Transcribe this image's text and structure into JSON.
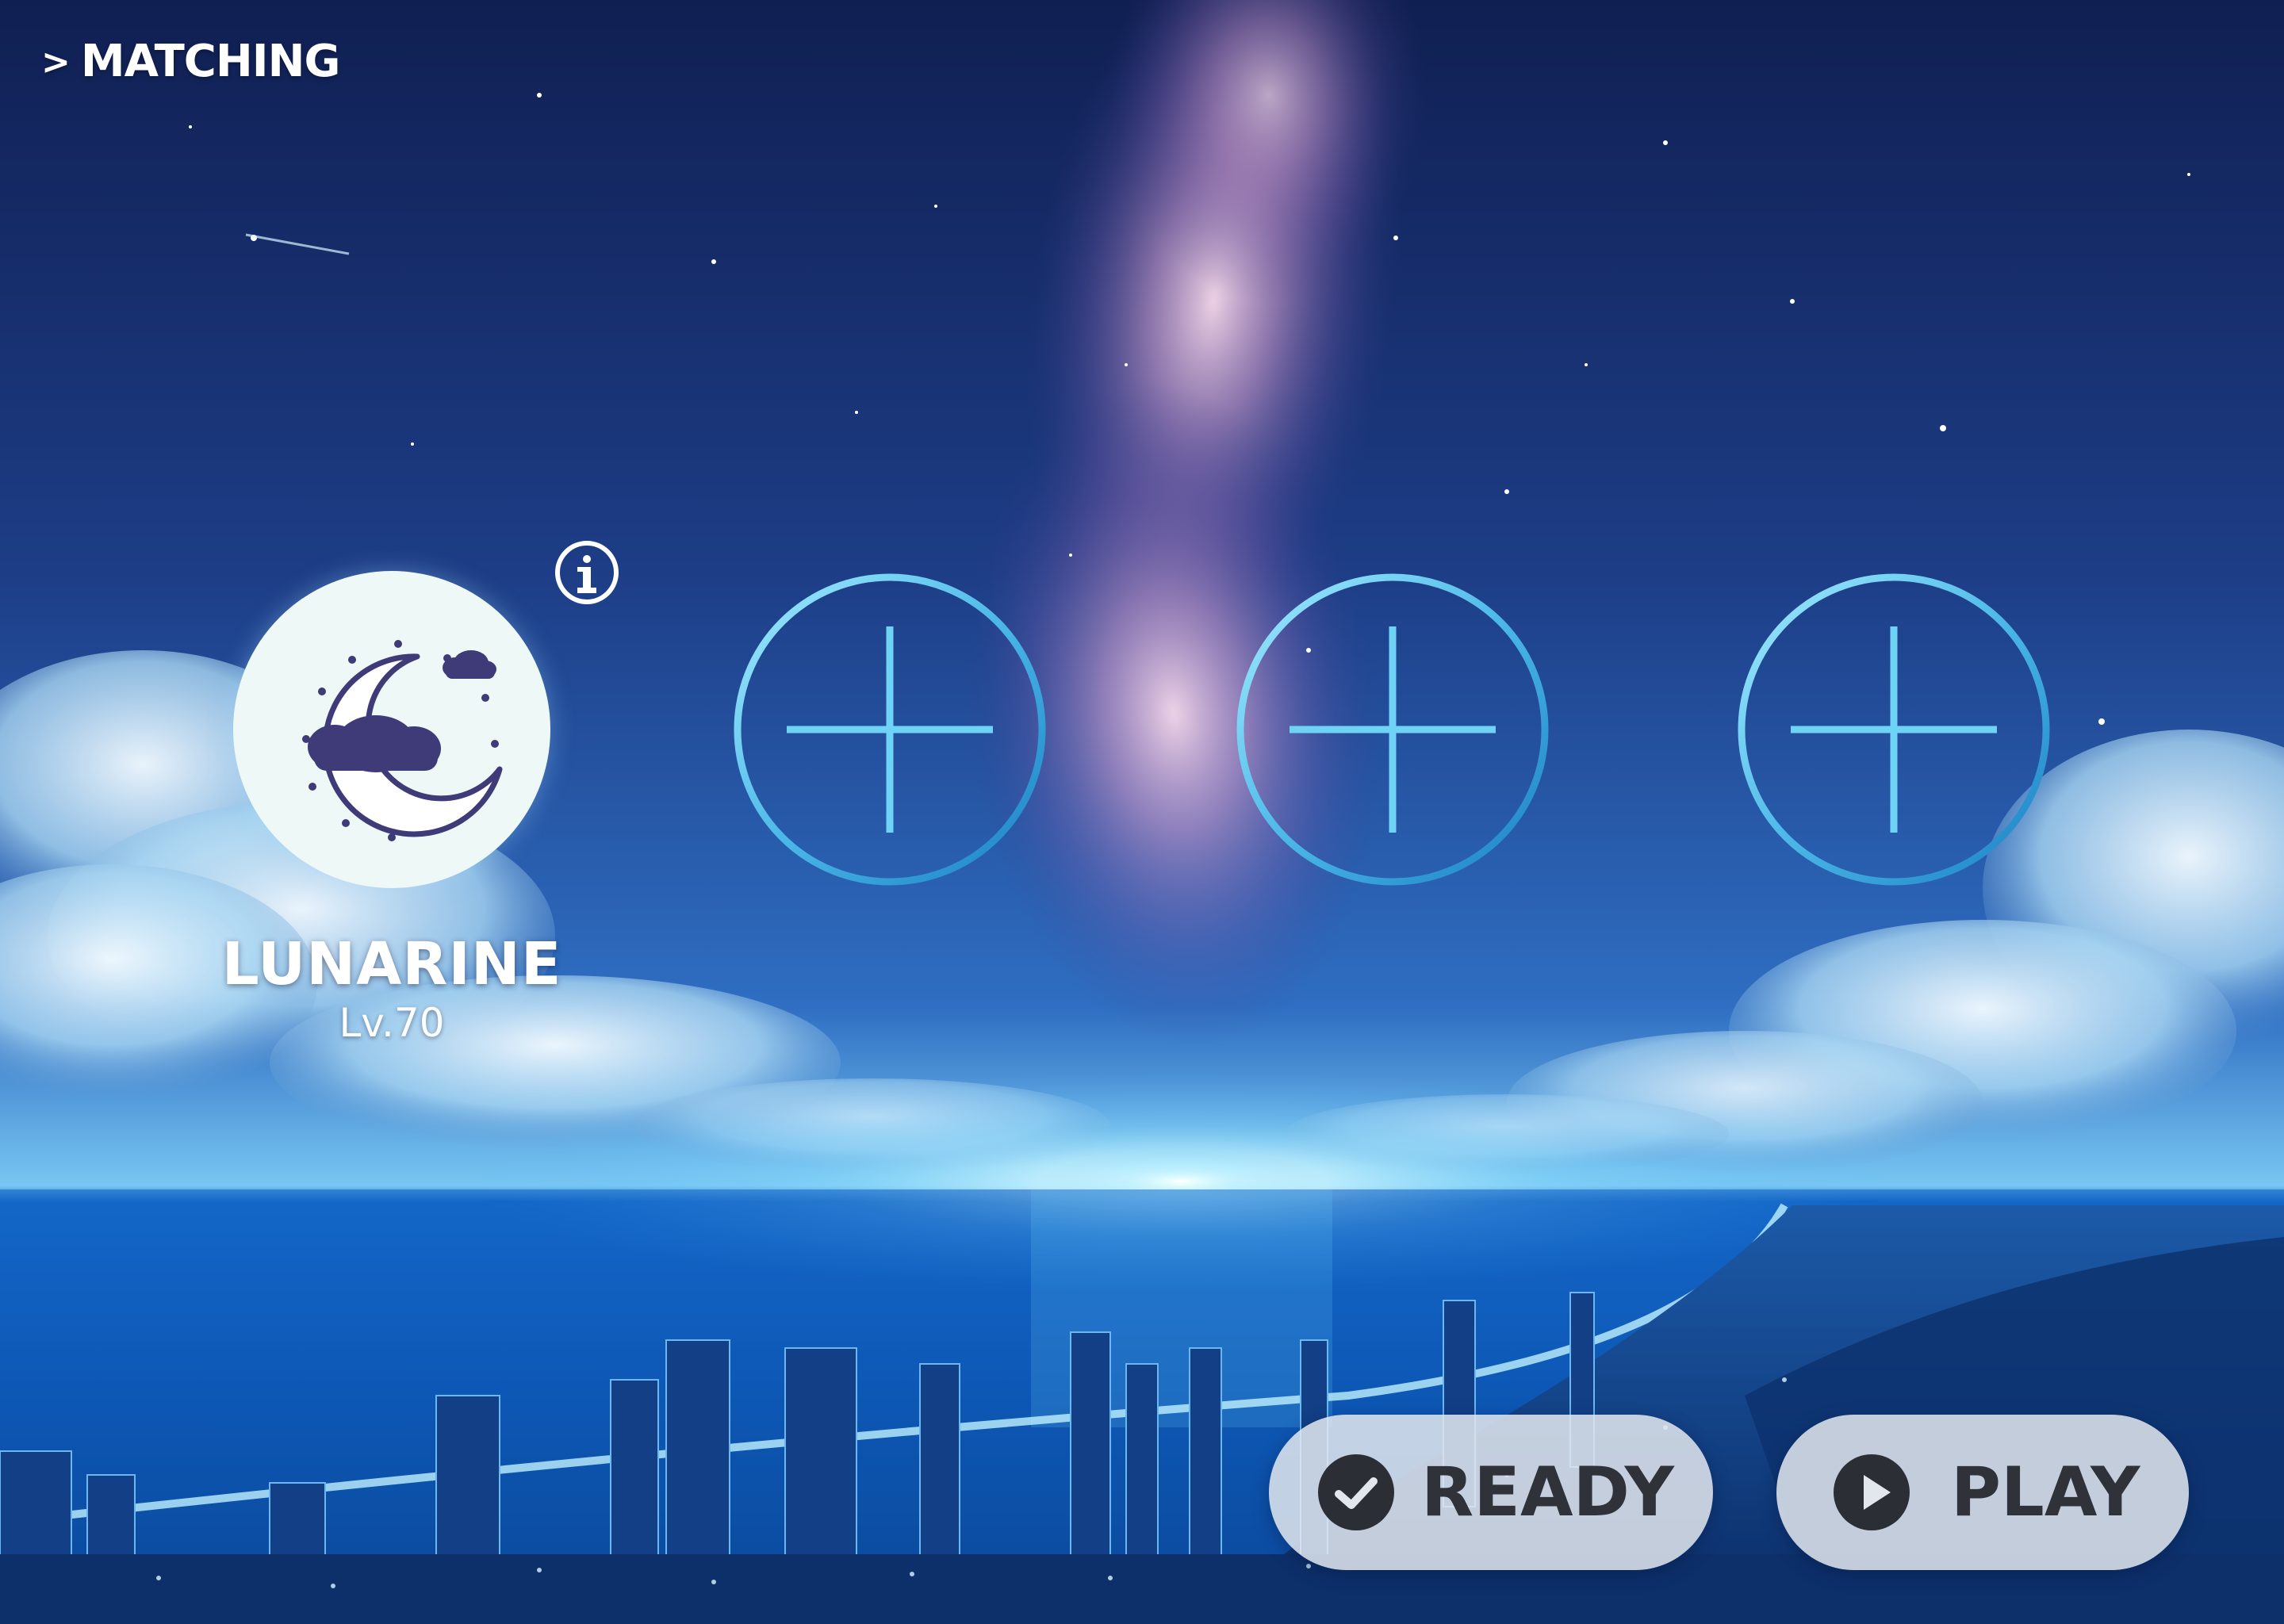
{
  "screen": {
    "title": "MATCHING",
    "title_prefix": ">"
  },
  "player": {
    "name": "LUNARINE",
    "level": "Lv.70",
    "avatar": "moon-and-clouds-avatar"
  },
  "empty_slots": [
    {
      "icon": "plus-icon"
    },
    {
      "icon": "plus-icon"
    },
    {
      "icon": "plus-icon"
    }
  ],
  "buttons": {
    "ready": {
      "label": "READY",
      "icon": "check-circle-icon"
    },
    "play": {
      "label": "PLAY",
      "icon": "play-circle-icon"
    }
  },
  "icons": {
    "info": "info-icon"
  },
  "colors": {
    "sky_top": "#12245a",
    "sky_mid": "#2c5cb0",
    "horizon_glow": "#bdf3ff",
    "ocean": "#0f5fc1",
    "slot_ring": "#5cc7ef",
    "button_bg": "#e2e7ee",
    "button_text": "#2f3239",
    "avatar_bg": "#eef8f7",
    "avatar_accent": "#3f3b78"
  }
}
